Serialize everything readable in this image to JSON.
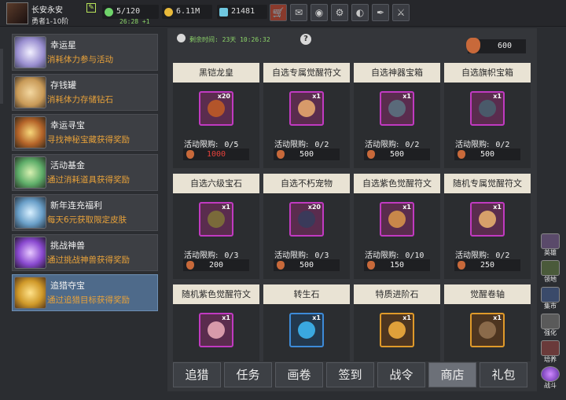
{
  "player": {
    "name": "长安永安",
    "level": "勇者1-10阶"
  },
  "resources": {
    "stamina": "5/120",
    "stamina_timer": "26:28 +1",
    "gold": "6.11M",
    "gems": "21481"
  },
  "toolbar": {
    "icons": [
      "shop-icon",
      "mail-icon",
      "gamepad-icon",
      "gear-icon",
      "color-wheel-icon",
      "quill-icon",
      "crossed-swords-icon"
    ]
  },
  "sidebar": {
    "items": [
      {
        "title": "幸运星",
        "desc": "消耗体力参与活动"
      },
      {
        "title": "存钱罐",
        "desc": "消耗体力存储钻石"
      },
      {
        "title": "幸运寻宝",
        "desc": "寻找神秘宝藏获得奖励"
      },
      {
        "title": "活动基金",
        "desc": "通过消耗道具获得奖励"
      },
      {
        "title": "新年连充福利",
        "desc": "每天6元获取限定皮肤"
      },
      {
        "title": "挑战神兽",
        "desc": "通过挑战神兽获得奖励"
      },
      {
        "title": "追猎夺宝",
        "desc": "通过追猎目标获得奖励"
      }
    ]
  },
  "shop": {
    "countdown_label": "剩余时间:",
    "countdown_value": "23天 10:26:32",
    "currency": "600",
    "items": [
      {
        "name": "黑铠龙皇",
        "count": "x20",
        "limit_label": "活动限购:",
        "limit": "0/5",
        "price": "1000"
      },
      {
        "name": "自选专属觉醒符文",
        "count": "x1",
        "limit_label": "活动限购:",
        "limit": "0/2",
        "price": "500"
      },
      {
        "name": "自选神器宝箱",
        "count": "x1",
        "limit_label": "活动限购:",
        "limit": "0/2",
        "price": "500"
      },
      {
        "name": "自选旗帜宝箱",
        "count": "x1",
        "limit_label": "活动限购:",
        "limit": "0/2",
        "price": "500"
      },
      {
        "name": "自选六级宝石",
        "count": "x1",
        "limit_label": "活动限购:",
        "limit": "0/3",
        "price": "200"
      },
      {
        "name": "自选不朽宠物",
        "count": "x20",
        "limit_label": "活动限购:",
        "limit": "0/3",
        "price": "500"
      },
      {
        "name": "自选紫色觉醒符文",
        "count": "x1",
        "limit_label": "活动限购:",
        "limit": "0/10",
        "price": "150"
      },
      {
        "name": "随机专属觉醒符文",
        "count": "x1",
        "limit_label": "活动限购:",
        "limit": "0/2",
        "price": "250"
      },
      {
        "name": "随机紫色觉醒符文",
        "count": "x1"
      },
      {
        "name": "转生石",
        "count": "x1"
      },
      {
        "name": "特质进阶石",
        "count": "x1"
      },
      {
        "name": "觉醒卷轴",
        "count": "x1"
      }
    ]
  },
  "tabs": [
    "追猎",
    "任务",
    "画卷",
    "签到",
    "战令",
    "商店",
    "礼包"
  ],
  "selected_tab": "商店",
  "right_menu": [
    "英雄",
    "领地",
    "集市",
    "强化",
    "培养",
    "战斗"
  ],
  "colors": {
    "accent_orange": "#e8a23a",
    "active_blue": "#4e6a8a",
    "price_red": "#e5413a",
    "timer_green": "#8dd66a"
  }
}
